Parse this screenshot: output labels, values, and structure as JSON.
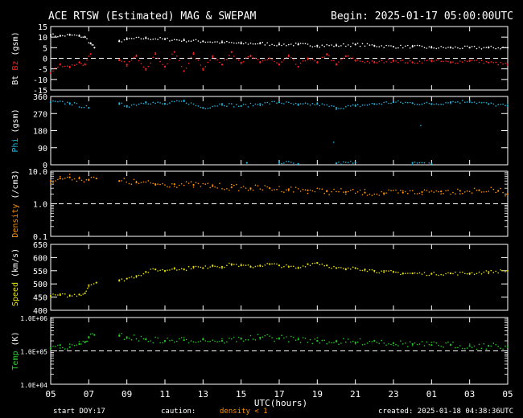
{
  "header": {
    "title": "ACE RTSW (Estimated) MAG & SWEPAM",
    "begin": "Begin: 2025-01-17 05:00:00UTC"
  },
  "footer": {
    "start_doy_label": "start DOY:",
    "start_doy": "17",
    "caution_label": "caution:",
    "caution_note": "density < 1",
    "created": "created: 2025-01-18 04:38:36UTC"
  },
  "colors": {
    "bt": "#ffffff",
    "bz": "#ff2020",
    "phi": "#20b8e0",
    "density": "#ff9000",
    "speed": "#e8e000",
    "temp": "#20d020",
    "frame": "#ffffff",
    "background": "#000000"
  },
  "chart_data": {
    "type": "scatter",
    "xlabel": "UTC(hours)",
    "x_ticks": [
      "05",
      "07",
      "09",
      "11",
      "13",
      "15",
      "17",
      "19",
      "21",
      "23",
      "01",
      "03",
      "05"
    ],
    "panels": [
      {
        "id": "mag",
        "ylabel_parts": [
          {
            "text": "Bt",
            "color": "#ffffff"
          },
          {
            "text": "Bz",
            "color": "#ff2020"
          },
          {
            "text": "(gsm)",
            "color": "#ffffff"
          }
        ],
        "ylim": [
          -15,
          15
        ],
        "scale": "linear",
        "ticks": [
          "10",
          "5",
          "0",
          "-5",
          "-10",
          "-15"
        ],
        "tick_values": [
          10,
          5,
          0,
          -5,
          -10,
          -15
        ],
        "top_tick": "15",
        "reference_line": 0,
        "series": [
          {
            "name": "Bt",
            "points": [
              [
                0,
                11
              ],
              [
                0.5,
                10.5
              ],
              [
                1,
                11
              ],
              [
                1.5,
                10.5
              ],
              [
                1.8,
                10
              ],
              [
                2.1,
                7
              ],
              [
                2.3,
                5
              ],
              [
                3.6,
                8
              ],
              [
                4,
                9
              ],
              [
                5,
                9.5
              ],
              [
                6,
                9
              ],
              [
                7,
                8.5
              ],
              [
                8,
                8
              ],
              [
                9,
                7.5
              ],
              [
                10,
                7
              ],
              [
                11,
                7
              ],
              [
                12,
                6.5
              ],
              [
                13,
                6.5
              ],
              [
                14,
                6
              ],
              [
                15,
                6
              ],
              [
                16,
                6.5
              ],
              [
                17,
                6
              ],
              [
                18,
                5.5
              ],
              [
                19,
                5.5
              ],
              [
                20,
                5
              ],
              [
                21,
                5
              ],
              [
                22,
                5
              ],
              [
                23,
                5
              ],
              [
                24,
                5
              ]
            ]
          },
          {
            "name": "Bz",
            "points": [
              [
                0,
                -7
              ],
              [
                0.5,
                -3
              ],
              [
                1,
                -4
              ],
              [
                1.5,
                -2
              ],
              [
                1.8,
                -3
              ],
              [
                2.1,
                2
              ],
              [
                3.6,
                -1
              ],
              [
                4,
                -3
              ],
              [
                4.5,
                1
              ],
              [
                5,
                -5
              ],
              [
                5.5,
                2
              ],
              [
                6,
                -4
              ],
              [
                6.5,
                3
              ],
              [
                7,
                -6
              ],
              [
                7.5,
                2
              ],
              [
                8,
                -5
              ],
              [
                8.5,
                1
              ],
              [
                9,
                -3
              ],
              [
                9.5,
                3
              ],
              [
                10,
                -2
              ],
              [
                10.5,
                1
              ],
              [
                11,
                -2
              ],
              [
                11.5,
                0
              ],
              [
                12,
                -3
              ],
              [
                12.5,
                1
              ],
              [
                13,
                -4
              ],
              [
                13.5,
                0
              ],
              [
                14,
                -2
              ],
              [
                14.5,
                2
              ],
              [
                15,
                -3
              ],
              [
                15.5,
                1
              ],
              [
                16,
                -1
              ],
              [
                17,
                -2
              ],
              [
                18,
                -1
              ],
              [
                19,
                -2
              ],
              [
                20,
                -1
              ],
              [
                21,
                -2
              ],
              [
                22,
                -1
              ],
              [
                23,
                -2
              ],
              [
                24,
                -3
              ]
            ]
          }
        ]
      },
      {
        "id": "phi",
        "ylabel_parts": [
          {
            "text": "Phi",
            "color": "#20b8e0"
          },
          {
            "text": "(gsm)",
            "color": "#ffffff"
          }
        ],
        "ylim": [
          0,
          360
        ],
        "scale": "linear",
        "ticks": [
          "360",
          "270",
          "180",
          "90",
          "0"
        ],
        "tick_values": [
          360,
          270,
          180,
          90,
          0
        ],
        "series": [
          {
            "name": "Phi",
            "points": [
              [
                0,
                330
              ],
              [
                1,
                325
              ],
              [
                2,
                300
              ],
              [
                3.6,
                320
              ],
              [
                4,
                310
              ],
              [
                5,
                330
              ],
              [
                6,
                320
              ],
              [
                7,
                335
              ],
              [
                8,
                300
              ],
              [
                9,
                320
              ],
              [
                10,
                310
              ],
              [
                11,
                320
              ],
              [
                12,
                330
              ],
              [
                13,
                315
              ],
              [
                14,
                320
              ],
              [
                15,
                300
              ],
              [
                16,
                310
              ],
              [
                17,
                320
              ],
              [
                18,
                330
              ],
              [
                19,
                325
              ],
              [
                20,
                320
              ],
              [
                21,
                330
              ],
              [
                22,
                335
              ],
              [
                23,
                320
              ],
              [
                24,
                310
              ],
              [
                10.3,
                10
              ],
              [
                12,
                15
              ],
              [
                13,
                5
              ],
              [
                15,
                8
              ],
              [
                16,
                12
              ],
              [
                19,
                10
              ],
              [
                20,
                5
              ]
            ]
          }
        ]
      },
      {
        "id": "density",
        "ylabel_parts": [
          {
            "text": "Density",
            "color": "#ff9000"
          },
          {
            "text": "(/cm3)",
            "color": "#ffffff"
          }
        ],
        "ylim": [
          0.1,
          10
        ],
        "scale": "log",
        "ticks": [
          "10.0",
          "1.0",
          "0.1"
        ],
        "tick_values": [
          10,
          1,
          0.1
        ],
        "reference_line": 1,
        "series": [
          {
            "name": "Density",
            "points": [
              [
                0,
                5
              ],
              [
                0.5,
                6
              ],
              [
                1,
                6.5
              ],
              [
                1.5,
                6
              ],
              [
                2,
                5.5
              ],
              [
                2.4,
                6
              ],
              [
                3.6,
                5
              ],
              [
                4.5,
                4.5
              ],
              [
                5.5,
                4
              ],
              [
                6.5,
                4
              ],
              [
                7.5,
                3.8
              ],
              [
                8.5,
                3.5
              ],
              [
                9.5,
                3.2
              ],
              [
                10.5,
                3
              ],
              [
                11.5,
                3
              ],
              [
                12.5,
                2.8
              ],
              [
                13.5,
                2.6
              ],
              [
                14.5,
                2.4
              ],
              [
                15.5,
                2.3
              ],
              [
                16.5,
                2.2
              ],
              [
                17.5,
                2.1
              ],
              [
                18.5,
                2.2
              ],
              [
                19.5,
                2.3
              ],
              [
                20.5,
                2.4
              ],
              [
                21.5,
                2.5
              ],
              [
                22.5,
                2.6
              ],
              [
                23.5,
                2.5
              ],
              [
                24,
                2
              ]
            ]
          }
        ]
      },
      {
        "id": "speed",
        "ylabel_parts": [
          {
            "text": "Speed",
            "color": "#e8e000"
          },
          {
            "text": "(km/s)",
            "color": "#ffffff"
          }
        ],
        "ylim": [
          400,
          650
        ],
        "scale": "linear",
        "ticks": [
          "650",
          "600",
          "550",
          "500",
          "450",
          "400"
        ],
        "tick_values": [
          650,
          600,
          550,
          500,
          450,
          400
        ],
        "series": [
          {
            "name": "Speed",
            "points": [
              [
                0,
                455
              ],
              [
                0.5,
                458
              ],
              [
                1,
                455
              ],
              [
                1.5,
                460
              ],
              [
                1.8,
                465
              ],
              [
                2,
                495
              ],
              [
                2.4,
                505
              ],
              [
                3.6,
                512
              ],
              [
                4,
                520
              ],
              [
                4.5,
                530
              ],
              [
                5,
                545
              ],
              [
                5.5,
                555
              ],
              [
                6,
                550
              ],
              [
                6.5,
                560
              ],
              [
                7,
                555
              ],
              [
                7.5,
                565
              ],
              [
                8,
                560
              ],
              [
                8.5,
                570
              ],
              [
                9,
                565
              ],
              [
                9.5,
                575
              ],
              [
                10,
                570
              ],
              [
                10.5,
                565
              ],
              [
                11,
                570
              ],
              [
                11.5,
                575
              ],
              [
                12,
                570
              ],
              [
                12.5,
                565
              ],
              [
                13,
                560
              ],
              [
                13.5,
                575
              ],
              [
                14,
                580
              ],
              [
                14.5,
                570
              ],
              [
                15,
                560
              ],
              [
                15.5,
                555
              ],
              [
                16,
                560
              ],
              [
                16.5,
                555
              ],
              [
                17,
                550
              ],
              [
                17.5,
                545
              ],
              [
                18,
                545
              ],
              [
                18.5,
                540
              ],
              [
                19,
                540
              ],
              [
                20,
                538
              ],
              [
                21,
                540
              ],
              [
                22,
                540
              ],
              [
                23,
                545
              ],
              [
                24,
                550
              ]
            ]
          }
        ]
      },
      {
        "id": "temp",
        "ylabel_parts": [
          {
            "text": "Temp",
            "color": "#20d020"
          },
          {
            "text": "(K)",
            "color": "#ffffff"
          }
        ],
        "ylim": [
          10000,
          1000000
        ],
        "scale": "log",
        "ticks": [
          "1.0E+06",
          "1.0E+05",
          "1.0E+04"
        ],
        "tick_values": [
          1000000,
          100000,
          10000
        ],
        "reference_line": 100000,
        "series": [
          {
            "name": "Temp",
            "points": [
              [
                0,
                120000
              ],
              [
                0.5,
                150000
              ],
              [
                1,
                130000
              ],
              [
                1.5,
                160000
              ],
              [
                1.8,
                180000
              ],
              [
                2,
                250000
              ],
              [
                2.3,
                300000
              ],
              [
                3.6,
                280000
              ],
              [
                4,
                260000
              ],
              [
                5,
                220000
              ],
              [
                6,
                200000
              ],
              [
                7,
                210000
              ],
              [
                8,
                220000
              ],
              [
                9,
                200000
              ],
              [
                10,
                230000
              ],
              [
                11,
                250000
              ],
              [
                12,
                240000
              ],
              [
                13,
                220000
              ],
              [
                14,
                200000
              ],
              [
                15,
                190000
              ],
              [
                16,
                180000
              ],
              [
                17,
                200000
              ],
              [
                18,
                170000
              ],
              [
                19,
                160000
              ],
              [
                20,
                150000
              ],
              [
                21,
                150000
              ],
              [
                22,
                140000
              ],
              [
                23,
                140000
              ],
              [
                24,
                130000
              ]
            ]
          }
        ]
      }
    ]
  }
}
